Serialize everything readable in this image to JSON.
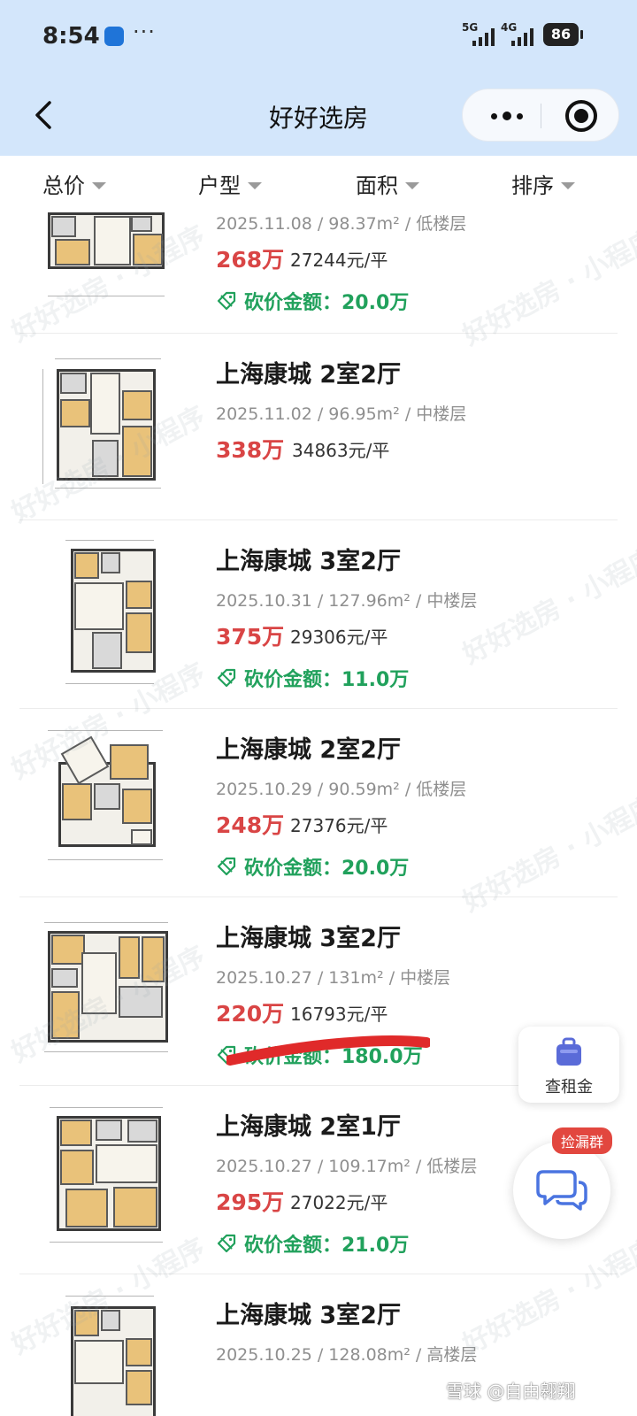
{
  "status_bar": {
    "time": "8:54",
    "net1": "5G",
    "net2": "4G",
    "battery": "86"
  },
  "nav": {
    "title": "好好选房"
  },
  "filters": [
    {
      "label": "总价"
    },
    {
      "label": "户型"
    },
    {
      "label": "面积"
    },
    {
      "label": "排序"
    }
  ],
  "listings": [
    {
      "title": "",
      "meta": "2025.11.08 / 98.37m² / 低楼层",
      "price": "268万",
      "unit_price": "27244元/平",
      "bargain": "砍价金额：20.0万"
    },
    {
      "title": "上海康城 2室2厅",
      "meta": "2025.11.02 / 96.95m² / 中楼层",
      "price": "338万",
      "unit_price": "34863元/平",
      "bargain": ""
    },
    {
      "title": "上海康城 3室2厅",
      "meta": "2025.10.31 / 127.96m² / 中楼层",
      "price": "375万",
      "unit_price": "29306元/平",
      "bargain": "砍价金额：11.0万"
    },
    {
      "title": "上海康城 2室2厅",
      "meta": "2025.10.29 / 90.59m² / 低楼层",
      "price": "248万",
      "unit_price": "27376元/平",
      "bargain": "砍价金额：20.0万"
    },
    {
      "title": "上海康城 3室2厅",
      "meta": "2025.10.27 / 131m² / 中楼层",
      "price": "220万",
      "unit_price": "16793元/平",
      "bargain": "砍价金额：180.0万"
    },
    {
      "title": "上海康城 2室1厅",
      "meta": "2025.10.27 / 109.17m² / 低楼层",
      "price": "295万",
      "unit_price": "27022元/平",
      "bargain": "砍价金额：21.0万"
    },
    {
      "title": "上海康城 3室2厅",
      "meta": "2025.10.25 / 128.08m² / 高楼层",
      "price": "",
      "unit_price": "",
      "bargain": ""
    }
  ],
  "watermark_text": "好好选房 · 小程序",
  "float": {
    "rent_label": "查租金",
    "chat_badge": "捡漏群"
  },
  "footer_watermark": "雪球 @自由翱翔"
}
